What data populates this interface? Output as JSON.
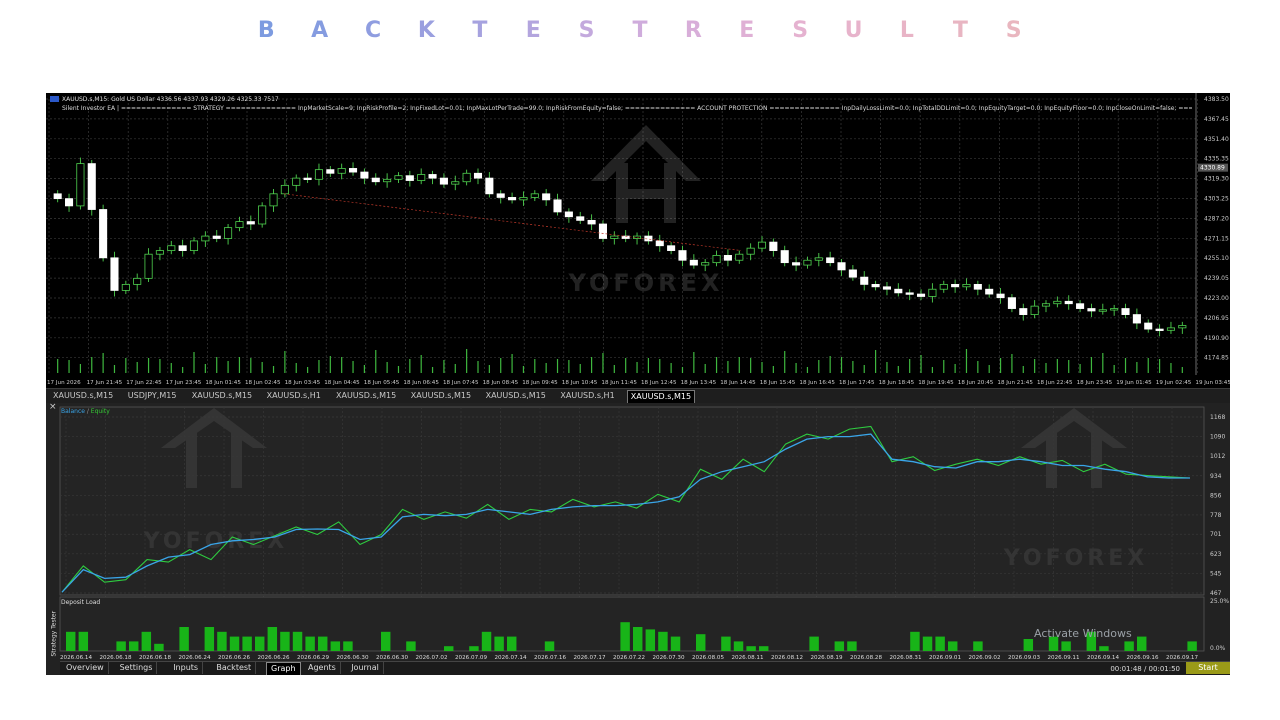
{
  "page_title_letters": [
    "B",
    "A",
    "C",
    "K",
    "T",
    "E",
    "S",
    "T",
    "R",
    "E",
    "S",
    "U",
    "L",
    "T",
    "S"
  ],
  "title_colors": [
    "#7d9be0",
    "#859ce0",
    "#8f9de0",
    "#9a9fdf",
    "#a6a2df",
    "#b3a5de",
    "#c3a9dd",
    "#cfacdc",
    "#d8aed9",
    "#dfb0d5",
    "#e5b2d0",
    "#e7b3cb",
    "#e8b4c6",
    "#e8b5c2",
    "#e9b6bf"
  ],
  "chart": {
    "symbol_info": "XAUUSD.s,M15: Gold US Dollar 4336.56 4337.93 4329.26 4325.33 7517",
    "ea_info": "Silent Investor EA | ============== STRATEGY ============== InpMarketScale=9; InpRiskProfile=2; InpFixedLot=0.01; InpMaxLotPerTrade=99.0; InpRiskFromEquity=false; ============== ACCOUNT PROTECTION ============== InpDailyLossLimit=0.0; InpTotalDDLimit=0.0; InpEquityTarget=0.0; InpEquityFloor=0.0; InpCloseOnLimit=false; ============== FILTERS ===",
    "price_labels": [
      "4383.50",
      "4367.45",
      "4351.40",
      "4335.35",
      "4319.30",
      "4303.25",
      "4287.20",
      "4271.15",
      "4255.10",
      "4239.05",
      "4223.00",
      "4206.95",
      "4190.90",
      "4174.85"
    ],
    "current_price": "4330.89",
    "time_labels": [
      "17 Jun 2026",
      "17 Jun 21:45",
      "17 Jun 22:45",
      "17 Jun 23:45",
      "18 Jun 01:45",
      "18 Jun 02:45",
      "18 Jun 03:45",
      "18 Jun 04:45",
      "18 Jun 05:45",
      "18 Jun 06:45",
      "18 Jun 07:45",
      "18 Jun 08:45",
      "18 Jun 09:45",
      "18 Jun 10:45",
      "18 Jun 11:45",
      "18 Jun 12:45",
      "18 Jun 13:45",
      "18 Jun 14:45",
      "18 Jun 15:45",
      "18 Jun 16:45",
      "18 Jun 17:45",
      "18 Jun 18:45",
      "18 Jun 19:45",
      "18 Jun 20:45",
      "18 Jun 21:45",
      "18 Jun 22:45",
      "18 Jun 23:45",
      "19 Jun 01:45",
      "19 Jun 02:45",
      "19 Jun 03:45"
    ],
    "watermark": "YOFOREX",
    "closes": [
      4301,
      4295,
      4330,
      4292,
      4252,
      4225,
      4230,
      4235,
      4255,
      4258,
      4262,
      4258,
      4266,
      4270,
      4268,
      4277,
      4282,
      4280,
      4295,
      4305,
      4312,
      4318,
      4317,
      4325,
      4322,
      4326,
      4323,
      4318,
      4315,
      4317,
      4320,
      4316,
      4321,
      4318,
      4313,
      4315,
      4322,
      4318,
      4305,
      4302,
      4300,
      4302,
      4305,
      4300,
      4290,
      4286,
      4283,
      4280,
      4268,
      4270,
      4268,
      4270,
      4266,
      4262,
      4258,
      4250,
      4246,
      4248,
      4254,
      4250,
      4255,
      4260,
      4265,
      4258,
      4248,
      4246,
      4250,
      4252,
      4248,
      4242,
      4236,
      4230,
      4228,
      4226,
      4223,
      4222,
      4220,
      4226,
      4230,
      4228,
      4230,
      4226,
      4222,
      4219,
      4210,
      4205,
      4212,
      4214,
      4216,
      4214,
      4210,
      4208,
      4209,
      4210,
      4205,
      4198,
      4193,
      4192,
      4194,
      4196
    ]
  },
  "symbol_tabs": [
    "XAUUSD.s,M15",
    "USDJPY,M15",
    "XAUUSD.s,M15",
    "XAUUSD.s,H1",
    "XAUUSD.s,M15",
    "XAUUSD.s,M15",
    "XAUUSD.s,M15",
    "XAUUSD.s,H1",
    "XAUUSD.s,M15"
  ],
  "active_symbol_tab": 8,
  "tester": {
    "close_symbol": "×",
    "legend_balance": "Balance",
    "legend_sep": " / ",
    "legend_equity": "Equity",
    "y_labels": [
      "1168",
      "1090",
      "1012",
      "934",
      "856",
      "778",
      "701",
      "623",
      "545",
      "467"
    ],
    "deposit_load_label": "Deposit Load",
    "deposit_labels": [
      "25.0%",
      "0.0%"
    ],
    "side_label": "Strategy Tester",
    "date_labels": [
      "2026.06.14",
      "2026.06.18",
      "2026.06.18",
      "2026.06.24",
      "2026.06.26",
      "2026.06.26",
      "2026.06.29",
      "2026.06.30",
      "2026.06.30",
      "2026.07.02",
      "2026.07.09",
      "2026.07.14",
      "2026.07.16",
      "2026.07.17",
      "2026.07.22",
      "2026.07.30",
      "2026.08.05",
      "2026.08.11",
      "2026.08.12",
      "2026.08.19",
      "2026.08.28",
      "2026.08.31",
      "2026.09.01",
      "2026.09.02",
      "2026.09.03",
      "2026.09.11",
      "2026.09.14",
      "2026.09.16",
      "2026.09.17"
    ],
    "activate_windows": "Activate Windows",
    "bottom_tabs": [
      "Overview",
      "Settings",
      "Inputs",
      "Backtest",
      "Graph",
      "Agents",
      "Journal"
    ],
    "active_bottom_tab": 4,
    "timer": "00:01:48 / 00:01:50",
    "start_label": "Start",
    "balance": [
      470,
      560,
      525,
      530,
      575,
      610,
      620,
      660,
      675,
      680,
      690,
      720,
      722,
      720,
      680,
      690,
      770,
      780,
      775,
      780,
      800,
      790,
      780,
      800,
      810,
      815,
      815,
      820,
      830,
      850,
      920,
      950,
      970,
      990,
      1040,
      1080,
      1090,
      1090,
      1100,
      1000,
      990,
      970,
      965,
      990,
      990,
      1000,
      990,
      975,
      975,
      960,
      950,
      930,
      925,
      925
    ],
    "equity": [
      470,
      575,
      510,
      520,
      600,
      590,
      640,
      600,
      690,
      660,
      695,
      730,
      700,
      750,
      660,
      700,
      800,
      760,
      790,
      765,
      820,
      760,
      800,
      790,
      840,
      810,
      830,
      805,
      860,
      830,
      960,
      920,
      1000,
      950,
      1060,
      1100,
      1080,
      1120,
      1130,
      990,
      1010,
      955,
      980,
      1000,
      975,
      1010,
      980,
      995,
      950,
      980,
      940,
      935,
      930,
      925
    ],
    "deposit_bars": [
      0.4,
      0.4,
      0,
      0,
      0.2,
      0.2,
      0.4,
      0.15,
      0,
      0.5,
      0,
      0.5,
      0.4,
      0.3,
      0.3,
      0.3,
      0.5,
      0.4,
      0.4,
      0.3,
      0.3,
      0.2,
      0.2,
      0,
      0,
      0.4,
      0,
      0.2,
      0,
      0,
      0.1,
      0,
      0.1,
      0.4,
      0.3,
      0.3,
      0,
      0,
      0.2,
      0,
      0,
      0,
      0,
      0,
      0.6,
      0.5,
      0.45,
      0.4,
      0.3,
      0,
      0.35,
      0,
      0.3,
      0.2,
      0.1,
      0.1,
      0,
      0,
      0,
      0.3,
      0,
      0.2,
      0.2,
      0,
      0,
      0,
      0,
      0.4,
      0.3,
      0.3,
      0.2,
      0,
      0.2,
      0,
      0,
      0,
      0.25,
      0,
      0.3,
      0.2,
      0,
      0.4,
      0.1,
      0,
      0.2,
      0.3,
      0,
      0,
      0,
      0.2
    ]
  }
}
